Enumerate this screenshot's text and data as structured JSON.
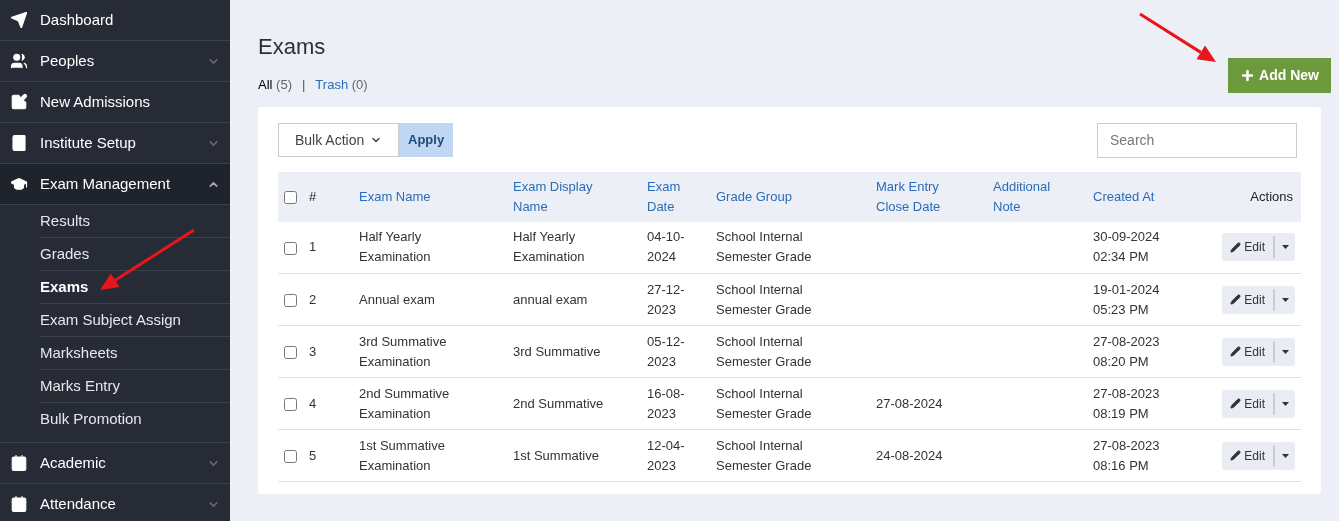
{
  "sidebar": {
    "items": [
      {
        "label": "Dashboard",
        "kind": "link"
      },
      {
        "label": "Peoples",
        "kind": "group",
        "expanded": false
      },
      {
        "label": "New Admissions",
        "kind": "link"
      },
      {
        "label": "Institute Setup",
        "kind": "group",
        "expanded": false
      },
      {
        "label": "Exam Management",
        "kind": "group",
        "expanded": true,
        "children": [
          {
            "label": "Results",
            "selected": false
          },
          {
            "label": "Grades",
            "selected": false
          },
          {
            "label": "Exams",
            "selected": true
          },
          {
            "label": "Exam Subject Assign",
            "selected": false
          },
          {
            "label": "Marksheets",
            "selected": false
          },
          {
            "label": "Marks Entry",
            "selected": false
          },
          {
            "label": "Bulk Promotion",
            "selected": false
          }
        ]
      },
      {
        "label": "Academic",
        "kind": "group",
        "expanded": false
      },
      {
        "label": "Attendance",
        "kind": "group",
        "expanded": false
      }
    ]
  },
  "page": {
    "title": "Exams",
    "filters": [
      {
        "label": "All",
        "count": "(5)",
        "selected": true
      },
      {
        "label": "Trash",
        "count": "(0)",
        "selected": false
      }
    ],
    "separator": "|",
    "add_button": "Add New"
  },
  "toolbar": {
    "bulk_action": "Bulk Action",
    "apply": "Apply",
    "search_placeholder": "Search"
  },
  "table": {
    "select_all_checked": false,
    "columns": [
      "#",
      "Exam Name",
      "Exam Display Name",
      "Exam Date",
      "Grade Group",
      "Mark Entry Close Date",
      "Additional Note",
      "Created At",
      "Actions"
    ],
    "rows": [
      {
        "checked": false,
        "cells": [
          "1",
          "Half Yearly Examination",
          "Half Yearly Examination",
          "04-10-2024",
          "School Internal Semester Grade",
          "",
          "",
          "30-09-2024 02:34 PM"
        ],
        "action": "Edit"
      },
      {
        "checked": false,
        "cells": [
          "2",
          "Annual exam",
          "annual exam",
          "27-12-2023",
          "School Internal Semester Grade",
          "",
          "",
          "19-01-2024 05:23 PM"
        ],
        "action": "Edit"
      },
      {
        "checked": false,
        "cells": [
          "3",
          "3rd Summative Examination",
          "3rd Summative",
          "05-12-2023",
          "School Internal Semester Grade",
          "",
          "",
          "27-08-2023 08:20 PM"
        ],
        "action": "Edit"
      },
      {
        "checked": false,
        "cells": [
          "4",
          "2nd Summative Examination",
          "2nd Summative",
          "16-08-2023",
          "School Internal Semester Grade",
          "27-08-2024",
          "",
          "27-08-2023 08:19 PM"
        ],
        "action": "Edit"
      },
      {
        "checked": false,
        "cells": [
          "5",
          "1st Summative Examination",
          "1st Summative",
          "12-04-2023",
          "School Internal Semester Grade",
          "24-08-2024",
          "",
          "27-08-2023 08:16 PM"
        ],
        "action": "Edit"
      }
    ]
  }
}
